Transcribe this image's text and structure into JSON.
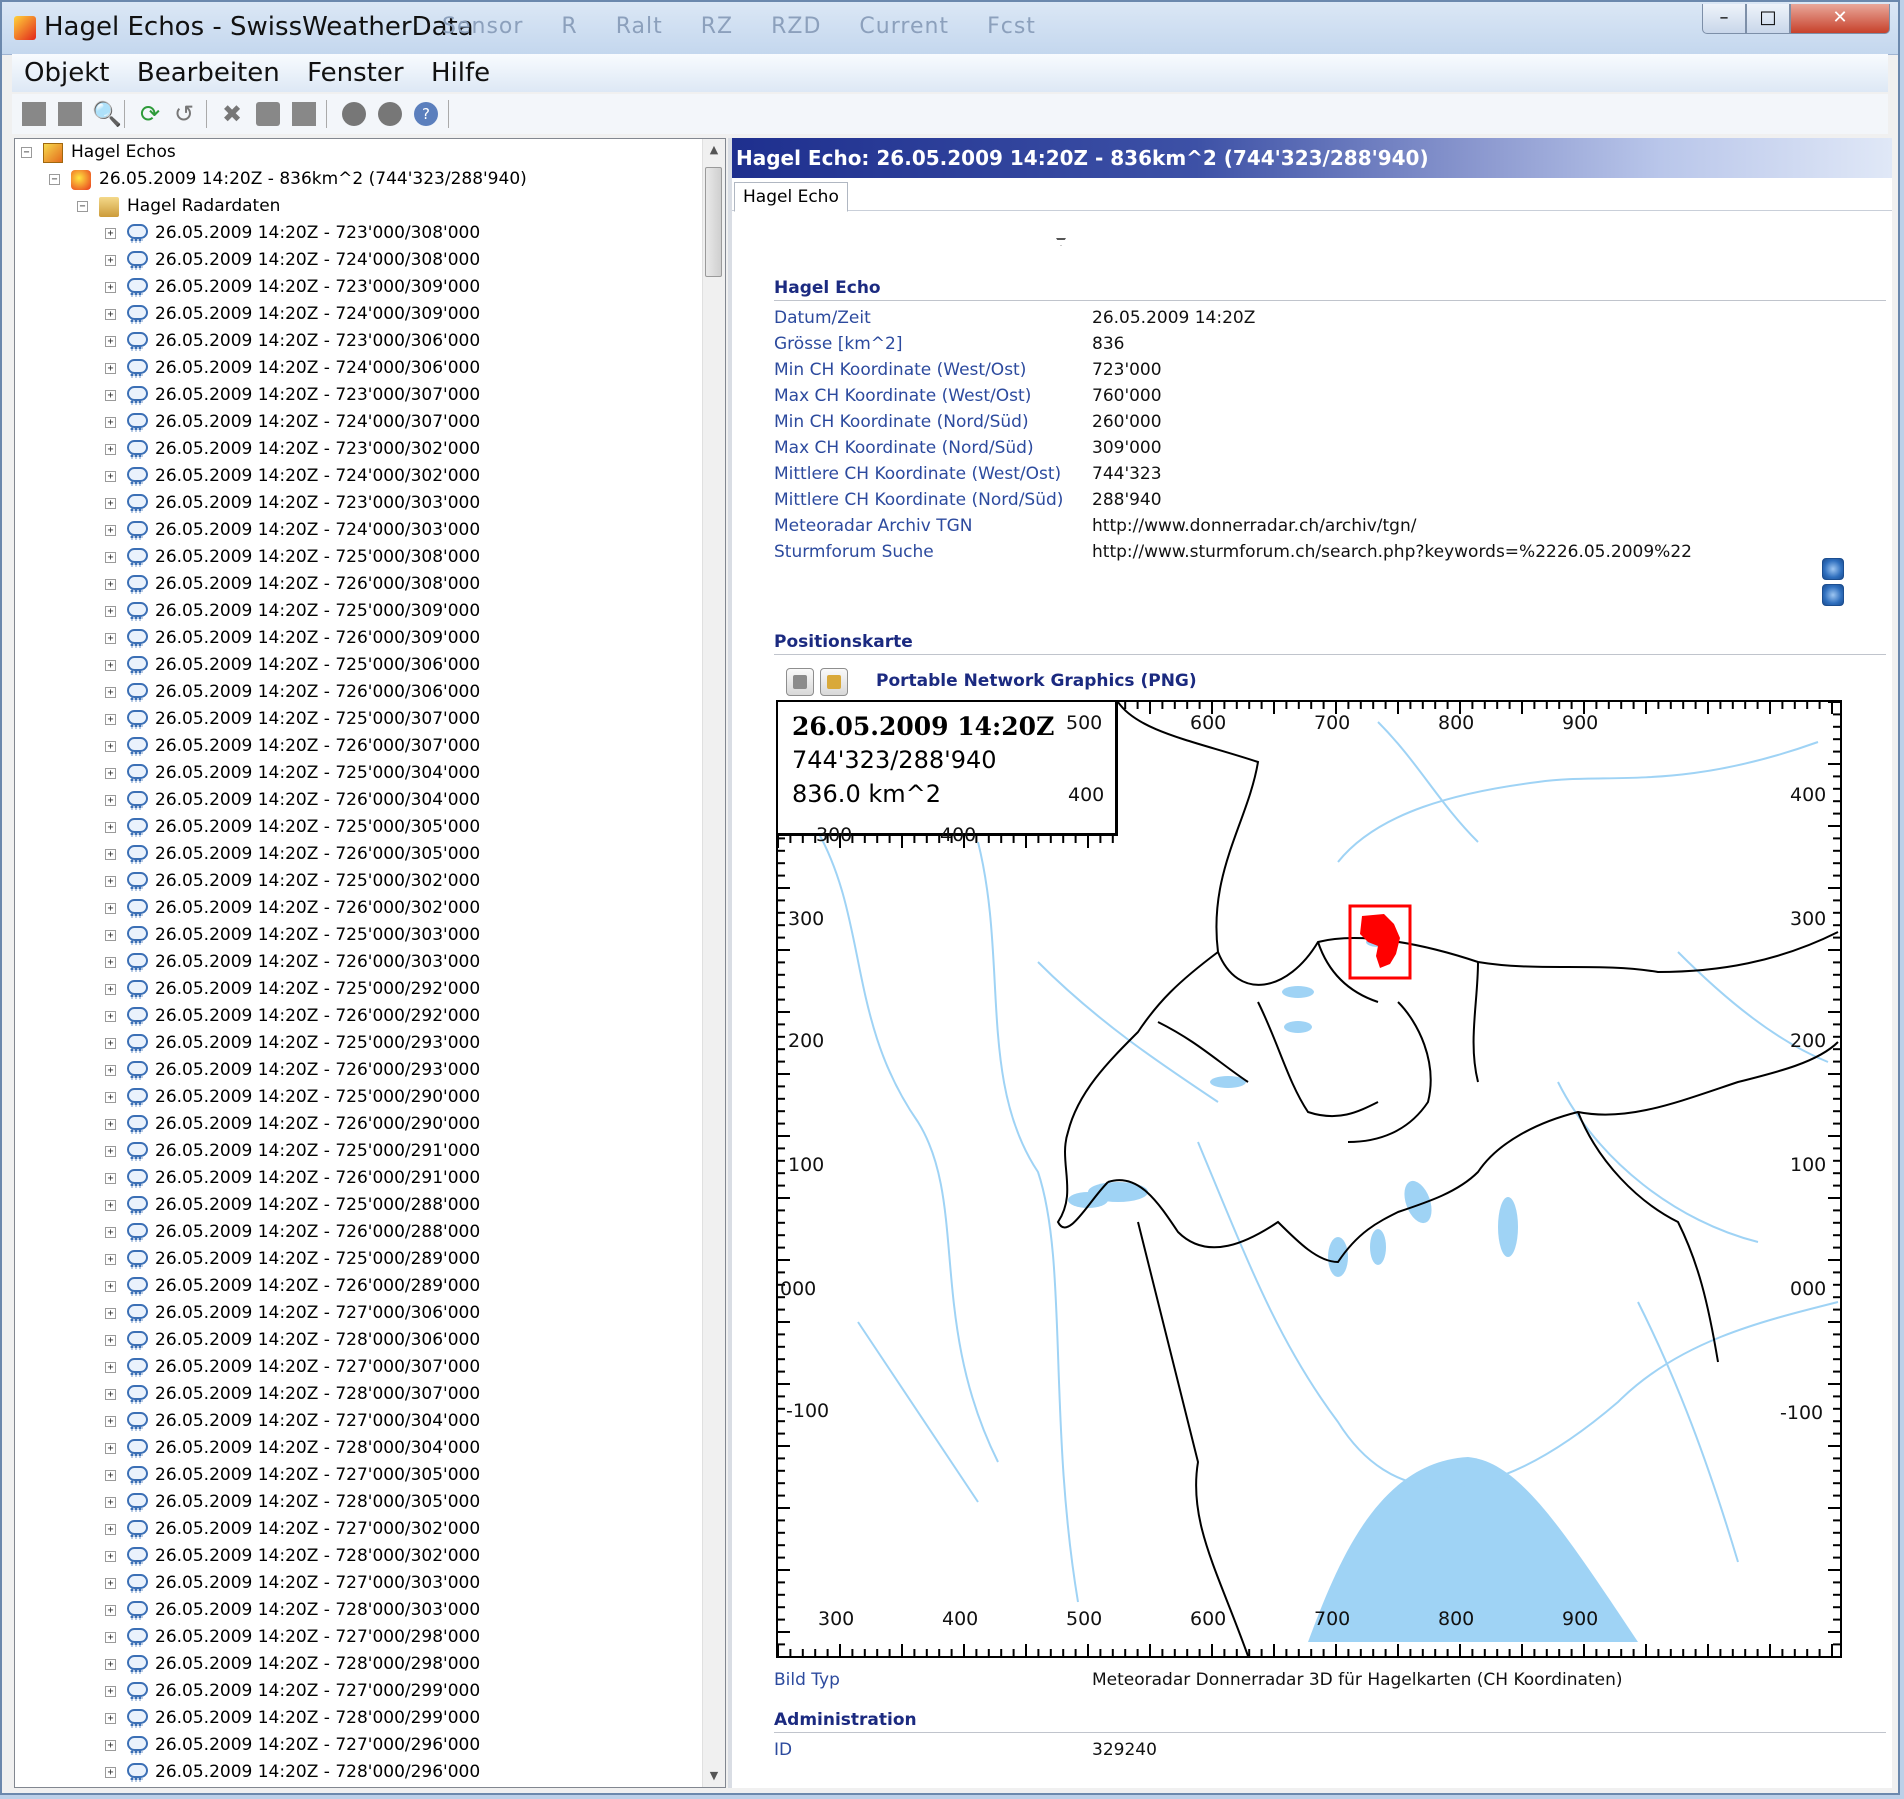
{
  "window": {
    "title": "Hagel Echos - SwissWeatherData",
    "ghost_tabs": [
      "Sensor",
      "R",
      "Ralt",
      "RZ",
      "RZD",
      "Current",
      "Fcst"
    ],
    "controls": {
      "minimize": "–",
      "maximize": "□",
      "close": "✕"
    }
  },
  "menu": [
    "Objekt",
    "Bearbeiten",
    "Fenster",
    "Hilfe"
  ],
  "toolbar_icons": [
    "new-icon",
    "save-icon",
    "search-icon",
    "refresh-icon",
    "undo-icon",
    "delete-icon",
    "print-icon",
    "document-icon",
    "stop-icon",
    "record-icon",
    "help-icon"
  ],
  "tree": {
    "root": "Hagel Echos",
    "echo": "26.05.2009 14:20Z - 836km^2 (744'323/288'940)",
    "folder": "Hagel Radardaten",
    "items": [
      "26.05.2009 14:20Z - 723'000/308'000",
      "26.05.2009 14:20Z - 724'000/308'000",
      "26.05.2009 14:20Z - 723'000/309'000",
      "26.05.2009 14:20Z - 724'000/309'000",
      "26.05.2009 14:20Z - 723'000/306'000",
      "26.05.2009 14:20Z - 724'000/306'000",
      "26.05.2009 14:20Z - 723'000/307'000",
      "26.05.2009 14:20Z - 724'000/307'000",
      "26.05.2009 14:20Z - 723'000/302'000",
      "26.05.2009 14:20Z - 724'000/302'000",
      "26.05.2009 14:20Z - 723'000/303'000",
      "26.05.2009 14:20Z - 724'000/303'000",
      "26.05.2009 14:20Z - 725'000/308'000",
      "26.05.2009 14:20Z - 726'000/308'000",
      "26.05.2009 14:20Z - 725'000/309'000",
      "26.05.2009 14:20Z - 726'000/309'000",
      "26.05.2009 14:20Z - 725'000/306'000",
      "26.05.2009 14:20Z - 726'000/306'000",
      "26.05.2009 14:20Z - 725'000/307'000",
      "26.05.2009 14:20Z - 726'000/307'000",
      "26.05.2009 14:20Z - 725'000/304'000",
      "26.05.2009 14:20Z - 726'000/304'000",
      "26.05.2009 14:20Z - 725'000/305'000",
      "26.05.2009 14:20Z - 726'000/305'000",
      "26.05.2009 14:20Z - 725'000/302'000",
      "26.05.2009 14:20Z - 726'000/302'000",
      "26.05.2009 14:20Z - 725'000/303'000",
      "26.05.2009 14:20Z - 726'000/303'000",
      "26.05.2009 14:20Z - 725'000/292'000",
      "26.05.2009 14:20Z - 726'000/292'000",
      "26.05.2009 14:20Z - 725'000/293'000",
      "26.05.2009 14:20Z - 726'000/293'000",
      "26.05.2009 14:20Z - 725'000/290'000",
      "26.05.2009 14:20Z - 726'000/290'000",
      "26.05.2009 14:20Z - 725'000/291'000",
      "26.05.2009 14:20Z - 726'000/291'000",
      "26.05.2009 14:20Z - 725'000/288'000",
      "26.05.2009 14:20Z - 726'000/288'000",
      "26.05.2009 14:20Z - 725'000/289'000",
      "26.05.2009 14:20Z - 726'000/289'000",
      "26.05.2009 14:20Z - 727'000/306'000",
      "26.05.2009 14:20Z - 728'000/306'000",
      "26.05.2009 14:20Z - 727'000/307'000",
      "26.05.2009 14:20Z - 728'000/307'000",
      "26.05.2009 14:20Z - 727'000/304'000",
      "26.05.2009 14:20Z - 728'000/304'000",
      "26.05.2009 14:20Z - 727'000/305'000",
      "26.05.2009 14:20Z - 728'000/305'000",
      "26.05.2009 14:20Z - 727'000/302'000",
      "26.05.2009 14:20Z - 728'000/302'000",
      "26.05.2009 14:20Z - 727'000/303'000",
      "26.05.2009 14:20Z - 728'000/303'000",
      "26.05.2009 14:20Z - 727'000/298'000",
      "26.05.2009 14:20Z - 728'000/298'000",
      "26.05.2009 14:20Z - 727'000/299'000",
      "26.05.2009 14:20Z - 728'000/299'000",
      "26.05.2009 14:20Z - 727'000/296'000",
      "26.05.2009 14:20Z - 728'000/296'000"
    ]
  },
  "detail": {
    "header": "Hagel Echo: 26.05.2009 14:20Z - 836km^2 (744'323/288'940)",
    "tab": "Hagel Echo",
    "section_echo": "Hagel Echo",
    "properties": [
      {
        "label": "Datum/Zeit",
        "value": "26.05.2009 14:20Z"
      },
      {
        "label": "Grösse [km^2]",
        "value": "836"
      },
      {
        "label": "Min CH Koordinate (West/Ost)",
        "value": "723'000"
      },
      {
        "label": "Max CH Koordinate (West/Ost)",
        "value": "760'000"
      },
      {
        "label": "Min CH Koordinate (Nord/Süd)",
        "value": "260'000"
      },
      {
        "label": "Max CH Koordinate (Nord/Süd)",
        "value": "309'000"
      },
      {
        "label": "Mittlere CH Koordinate (West/Ost)",
        "value": "744'323"
      },
      {
        "label": "Mittlere CH Koordinate (Nord/Süd)",
        "value": "288'940"
      },
      {
        "label": "Meteoradar Archiv TGN",
        "value": "http://www.donnerradar.ch/archiv/tgn/"
      },
      {
        "label": "Sturmforum Suche",
        "value": "http://www.sturmforum.ch/search.php?keywords=%2226.05.2009%22"
      }
    ],
    "section_map": "Positionskarte",
    "image_format": "Portable Network Graphics (PNG)",
    "map": {
      "date": "26.05.2009 14:20Z",
      "coord": "744'323/288'940",
      "area": "836.0 km^2",
      "x_ticks_top_inset": [
        "500",
        "600",
        "700",
        "800",
        "900"
      ],
      "y_ticks_inset_top": [
        "400"
      ],
      "x_ticks_top_main": [
        "300",
        "400"
      ],
      "y_ticks_left": [
        "300",
        "200",
        "100",
        "000",
        "-100"
      ],
      "y_ticks_right": [
        "400",
        "300",
        "200",
        "100",
        "000",
        "-100"
      ],
      "x_ticks_bottom": [
        "300",
        "400",
        "500",
        "600",
        "700",
        "800",
        "900"
      ],
      "echo_color": "#ff0000",
      "water_color": "#9fd3f5"
    },
    "bild_typ_label": "Bild Typ",
    "bild_typ_value": "Meteoradar Donnerradar 3D für Hagelkarten (CH Koordinaten)",
    "section_admin": "Administration",
    "id_label": "ID",
    "id_value": "329240"
  }
}
